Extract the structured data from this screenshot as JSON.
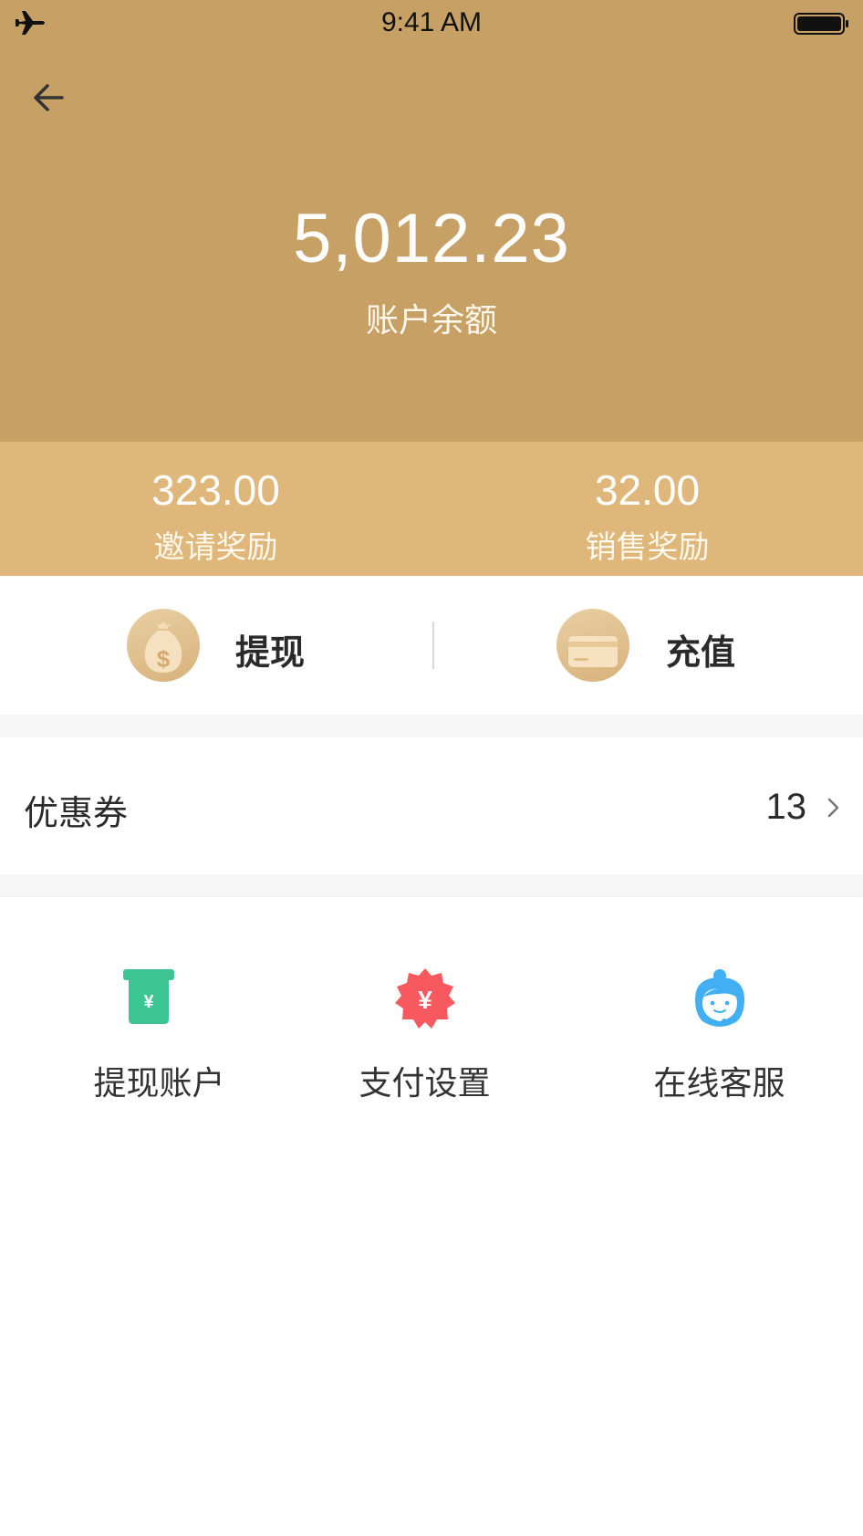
{
  "status_bar": {
    "time": "9:41 AM"
  },
  "header": {
    "balance": "5,012.23",
    "balance_label": "账户余额"
  },
  "rewards": [
    {
      "value": "323.00",
      "label": "邀请奖励"
    },
    {
      "value": "32.00",
      "label": "销售奖励"
    }
  ],
  "actions": [
    {
      "label": "提现",
      "icon": "money-bag-icon"
    },
    {
      "label": "充值",
      "icon": "card-icon"
    }
  ],
  "coupon": {
    "label": "优惠券",
    "count": "13"
  },
  "services": [
    {
      "label": "提现账户",
      "icon": "withdraw-account-icon",
      "color": "#3cc593"
    },
    {
      "label": "支付设置",
      "icon": "payment-settings-icon",
      "color": "#f7595f"
    },
    {
      "label": "在线客服",
      "icon": "customer-service-icon",
      "color": "#41aff2"
    }
  ],
  "colors": {
    "header_bg": "#c7a066",
    "rewards_bg": "#e0b77a",
    "accent_gold": "#d7b27a"
  }
}
